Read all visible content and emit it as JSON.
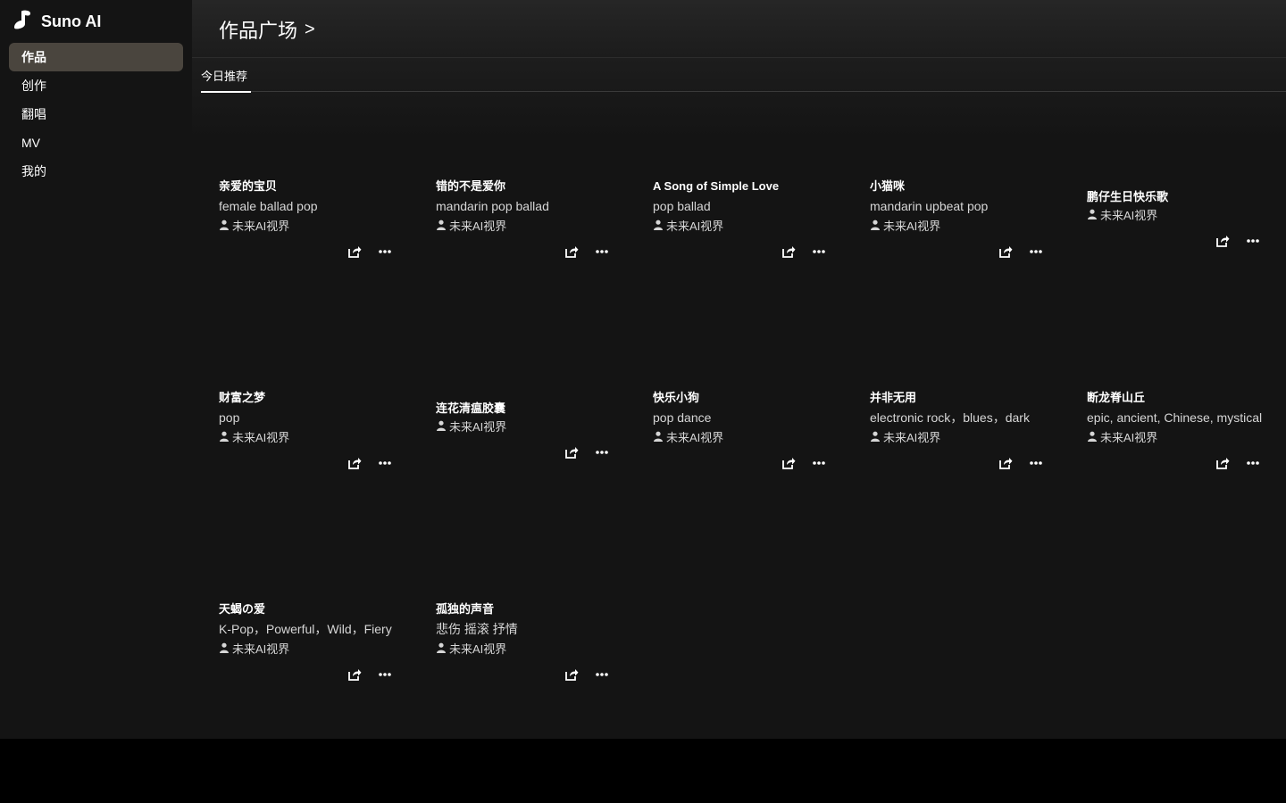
{
  "app": {
    "name": "Suno AI"
  },
  "sidebar": {
    "items": [
      {
        "label": "作品",
        "active": true
      },
      {
        "label": "创作",
        "active": false
      },
      {
        "label": "翻唱",
        "active": false
      },
      {
        "label": "MV",
        "active": false
      },
      {
        "label": "我的",
        "active": false
      }
    ]
  },
  "header": {
    "title": "作品广场",
    "chevron": ">"
  },
  "tabs": [
    {
      "label": "今日推荐",
      "active": true
    }
  ],
  "cards": [
    {
      "title": "亲爱的宝贝",
      "tags": "female ballad pop",
      "author": "未来AI视界"
    },
    {
      "title": "错的不是爱你",
      "tags": "mandarin pop ballad",
      "author": "未来AI视界"
    },
    {
      "title": "A Song of Simple Love",
      "tags": "pop ballad",
      "author": "未来AI视界"
    },
    {
      "title": "小猫咪",
      "tags": "mandarin upbeat pop",
      "author": "未来AI视界"
    },
    {
      "title": "鹏仔生日快乐歌",
      "tags": "",
      "author": "未来AI视界"
    },
    {
      "title": "财富之梦",
      "tags": "pop",
      "author": "未来AI视界"
    },
    {
      "title": "连花清瘟胶囊",
      "tags": "",
      "author": "未来AI视界"
    },
    {
      "title": "快乐小狗",
      "tags": "pop dance",
      "author": "未来AI视界"
    },
    {
      "title": "并非无用",
      "tags": "electronic rock，blues，dark",
      "author": "未来AI视界"
    },
    {
      "title": "断龙脊山丘",
      "tags": "epic, ancient, Chinese, mystical",
      "author": "未来AI视界"
    },
    {
      "title": "天蝎の爱",
      "tags": "K-Pop，Powerful，Wild，Fiery",
      "author": "未来AI视界"
    },
    {
      "title": "孤独的声音",
      "tags": "悲伤 摇滚 抒情",
      "author": "未来AI视界"
    }
  ],
  "icons": {
    "logo": "suno-logo-icon",
    "user": "user-icon",
    "share": "share-icon",
    "more": "more-icon"
  },
  "colors": {
    "background": "#141414",
    "active_nav": "#4a453e",
    "text": "#ffffff",
    "muted_text": "#d6d6d6"
  }
}
